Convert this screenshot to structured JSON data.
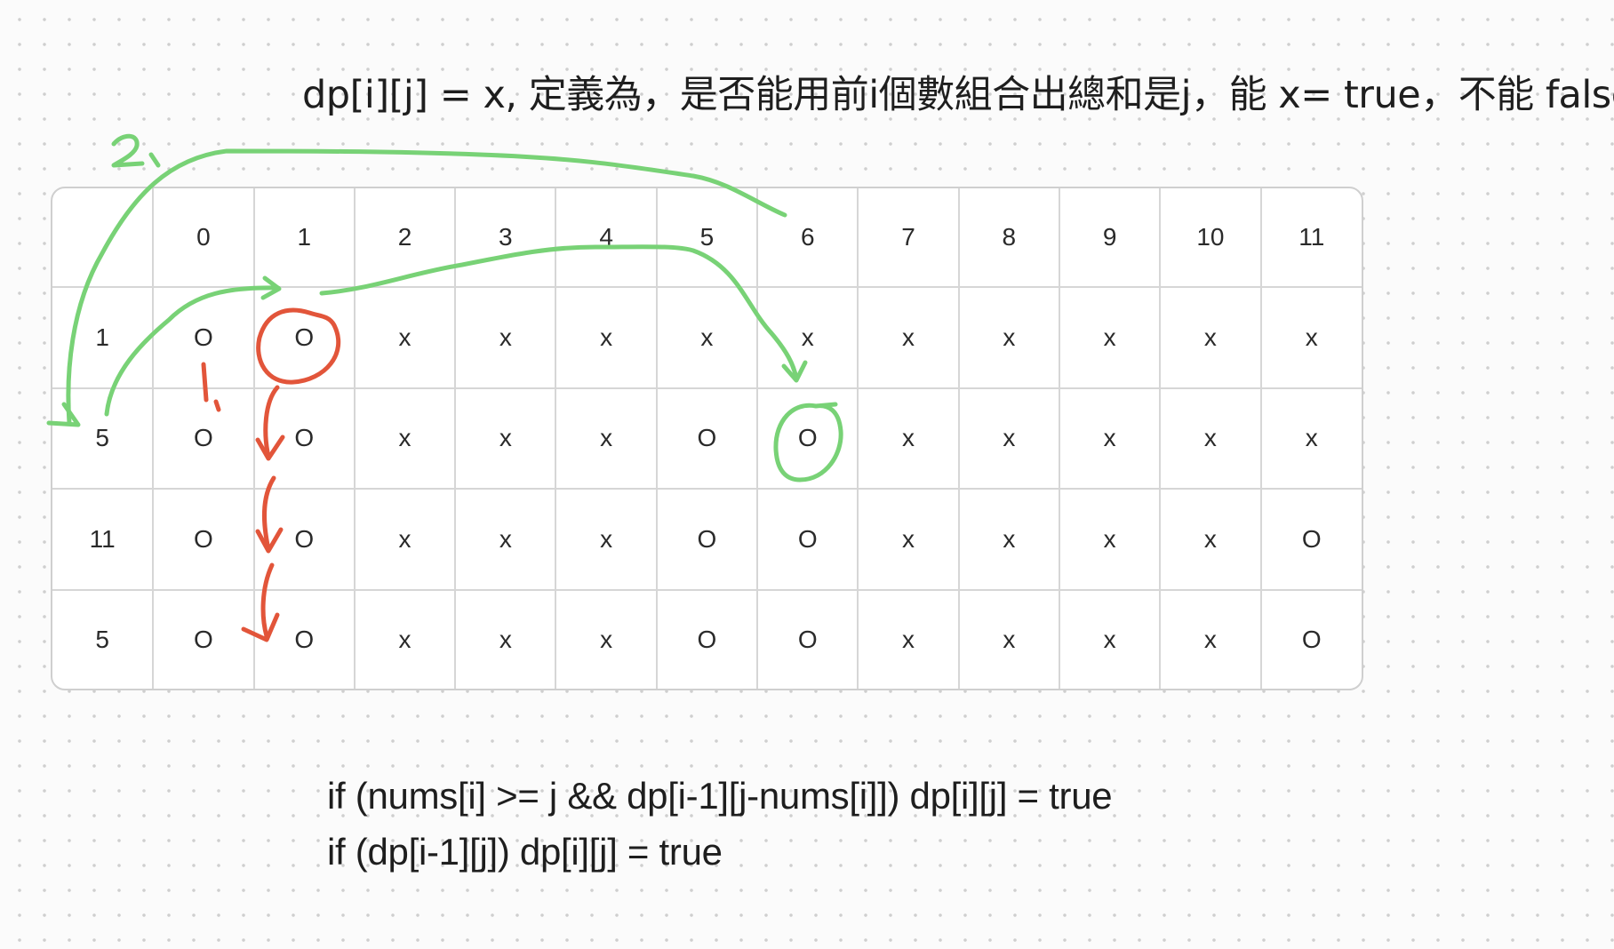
{
  "title": "dp[i][j] = x, 定義為，是否能用前i個數組合出總和是j，能 x= true，不能 false",
  "table": {
    "header": [
      "",
      "0",
      "1",
      "2",
      "3",
      "4",
      "5",
      "6",
      "7",
      "8",
      "9",
      "10",
      "11"
    ],
    "rows": [
      [
        "1",
        "O",
        "O",
        "x",
        "x",
        "x",
        "x",
        "x",
        "x",
        "x",
        "x",
        "x",
        "x"
      ],
      [
        "5",
        "O",
        "O",
        "x",
        "x",
        "x",
        "O",
        "O",
        "x",
        "x",
        "x",
        "x",
        "x"
      ],
      [
        "11",
        "O",
        "O",
        "x",
        "x",
        "x",
        "O",
        "O",
        "x",
        "x",
        "x",
        "x",
        "O"
      ],
      [
        "5",
        "O",
        "O",
        "x",
        "x",
        "x",
        "O",
        "O",
        "x",
        "x",
        "x",
        "x",
        "O"
      ]
    ]
  },
  "annotations": {
    "red_label": "1.",
    "green_label": "2.",
    "red_color": "#e2553a",
    "green_color": "#78d276"
  },
  "formulas": [
    "if (nums[i] >= j && dp[i-1][j-nums[i]]) dp[i][j] = true",
    "if (dp[i-1][j]) dp[i][j] = true"
  ]
}
